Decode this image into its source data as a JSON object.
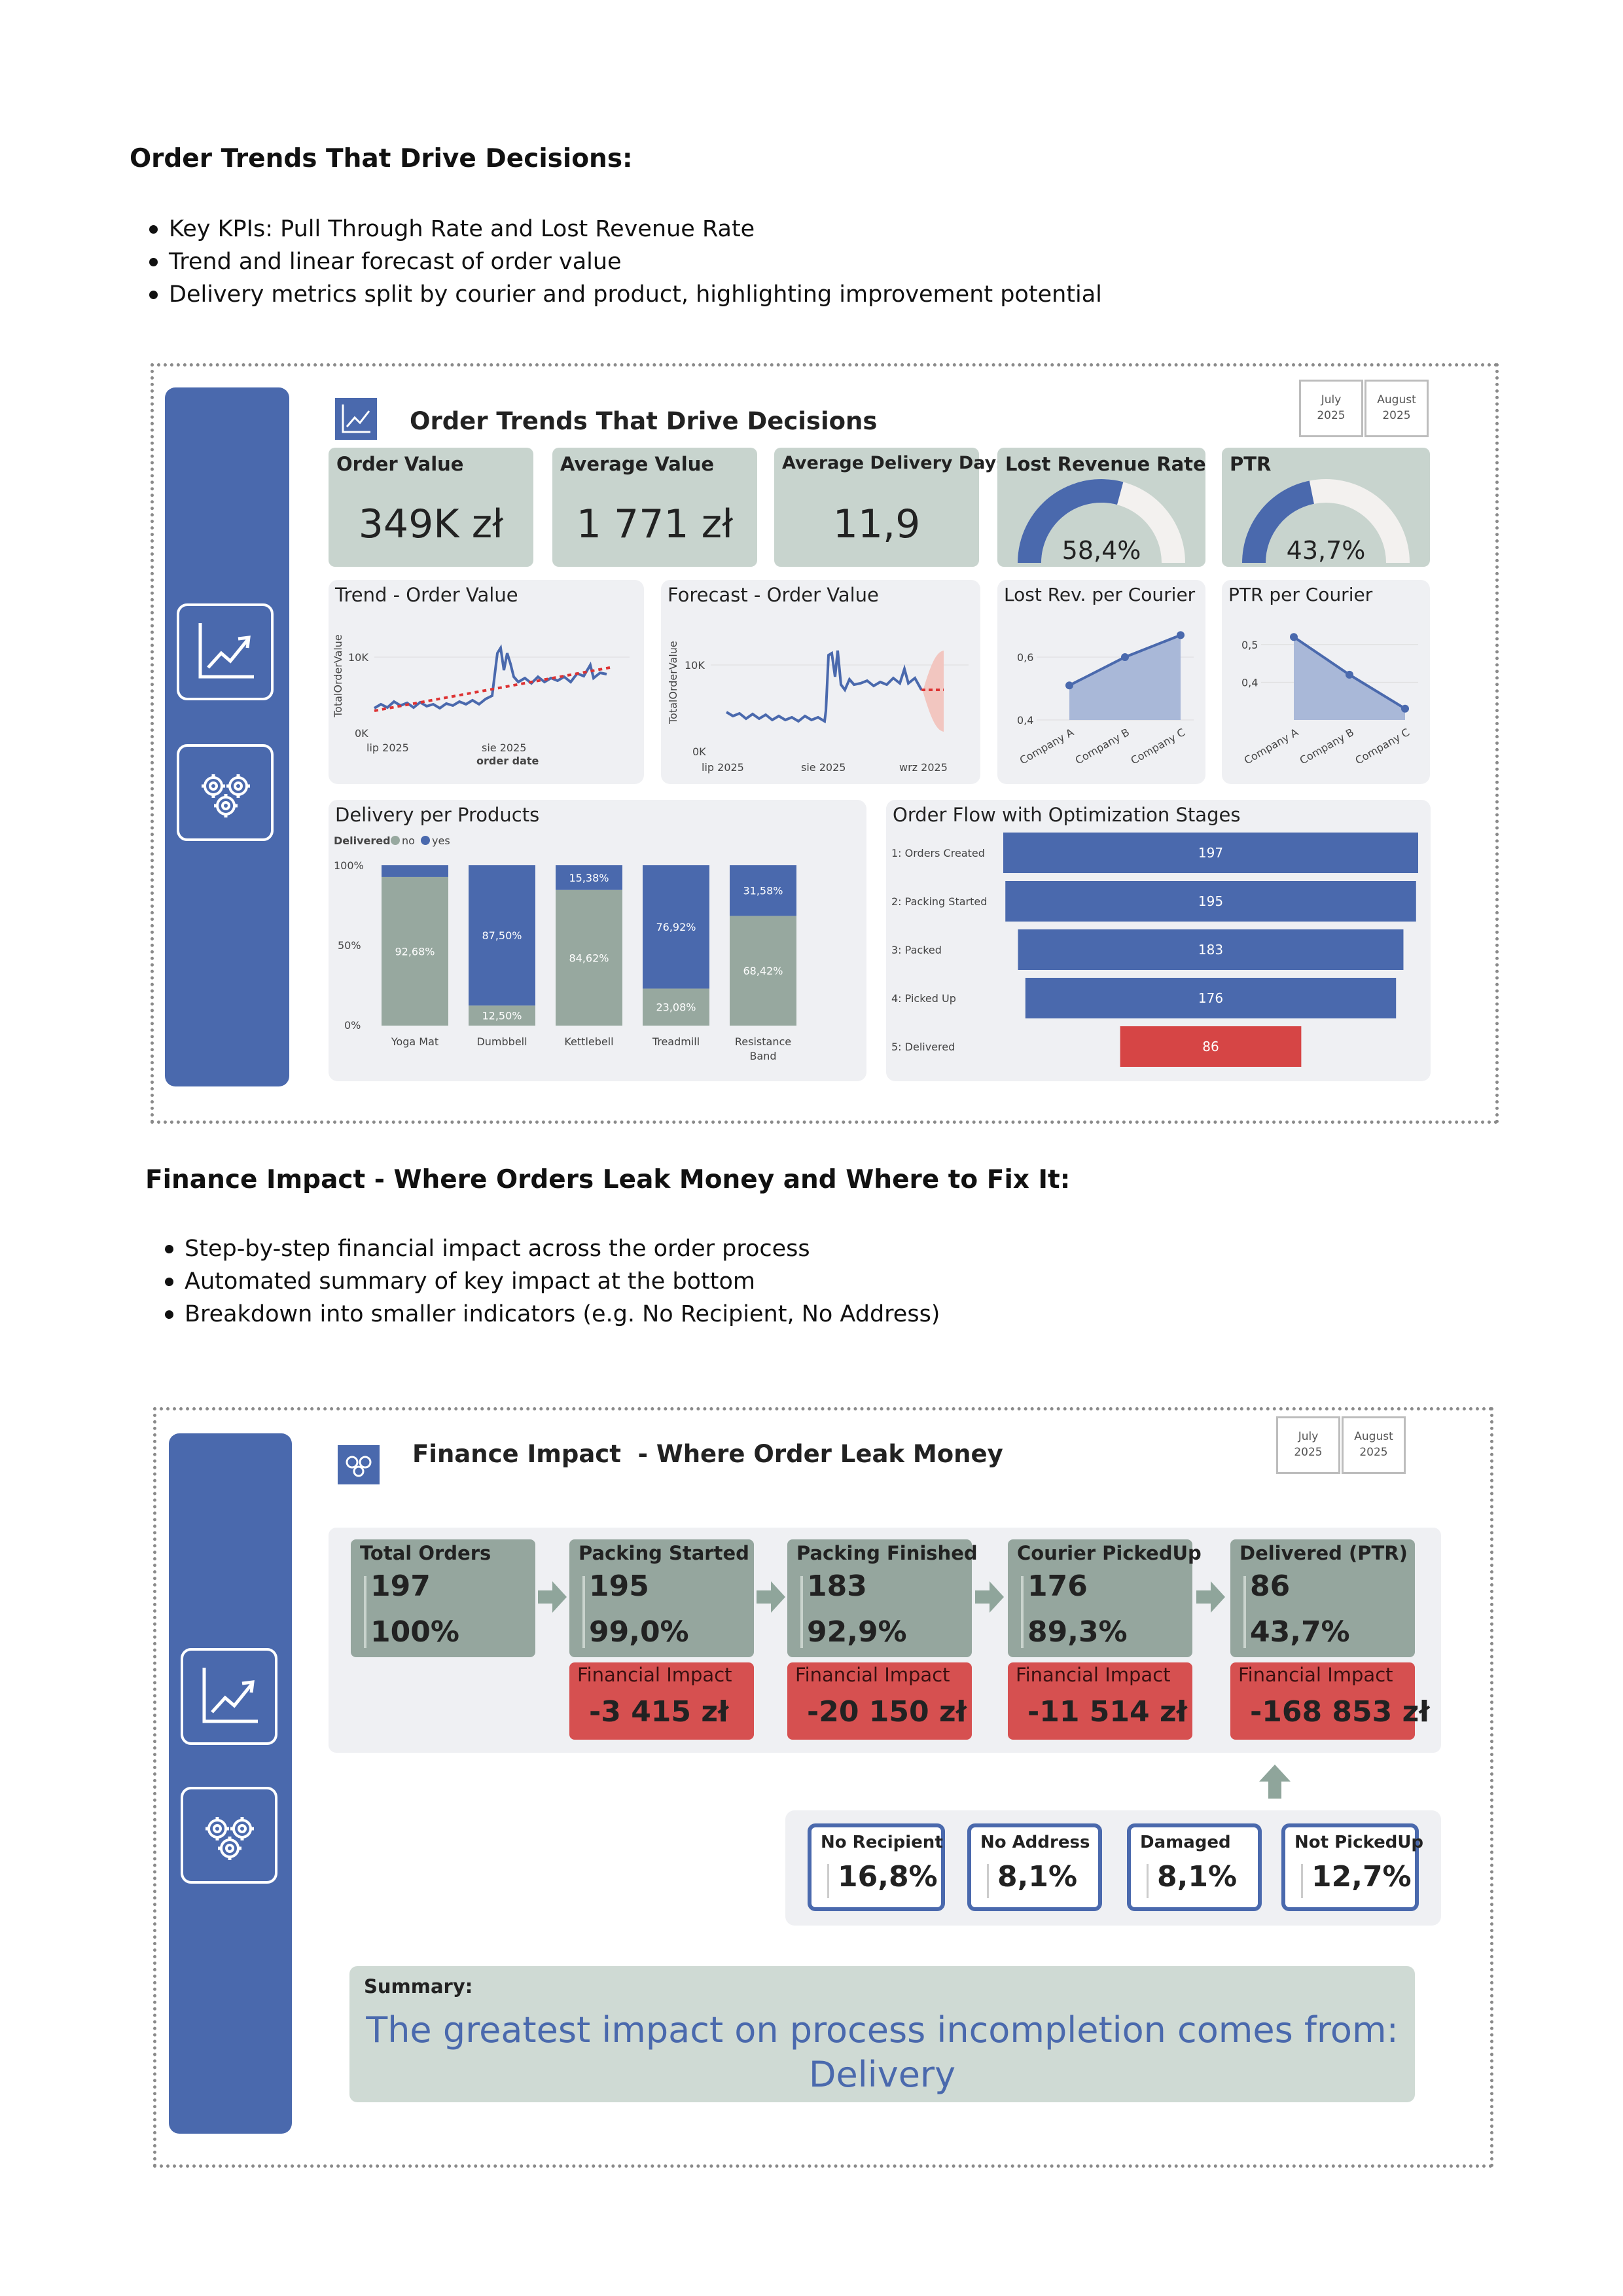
{
  "section1": {
    "heading": "Order Trends That Drive Decisions:",
    "bullets": [
      "Key KPIs: Pull Through Rate and Lost Revenue Rate",
      "Trend and linear forecast of order value",
      "Delivery metrics split by courier and product, highlighting improvement potential"
    ]
  },
  "dashboard1": {
    "title": "Order Trends That Drive Decisions",
    "month_buttons": [
      {
        "line1": "July",
        "line2": "2025"
      },
      {
        "line1": "August",
        "line2": "2025"
      }
    ],
    "kpis": [
      {
        "label": "Order Value",
        "value": "349K zł"
      },
      {
        "label": "Average Value",
        "value": "1 771 zł"
      },
      {
        "label": "Average Delivery Days",
        "value": "11,9"
      }
    ],
    "gauges": [
      {
        "label": "Lost Revenue Rate",
        "value_text": "58,4%",
        "value": 0.584
      },
      {
        "label": "PTR",
        "value_text": "43,7%",
        "value": 0.437
      }
    ],
    "trend": {
      "title": "Trend - Order Value",
      "ylabel": "TotalOrderValue",
      "xlabel": "order date",
      "yticks": [
        "10K",
        "0K"
      ],
      "xticks": [
        "lip 2025",
        "sie 2025"
      ]
    },
    "forecast": {
      "title": "Forecast - Order Value",
      "ylabel": "TotalOrderValue",
      "yticks": [
        "10K",
        "0K"
      ],
      "xticks": [
        "lip 2025",
        "sie 2025",
        "wrz 2025"
      ]
    },
    "delivery_products": {
      "title": "Delivery per Products",
      "legend_title": "Delivered",
      "legend": [
        "no",
        "yes"
      ],
      "yticks": [
        "100%",
        "50%",
        "0%"
      ]
    },
    "order_flow": {
      "title": "Order Flow with Optimization Stages"
    }
  },
  "chart_data": [
    {
      "type": "area",
      "title": "Lost Rev. per Courier",
      "categories": [
        "Company A",
        "Company B",
        "Company C"
      ],
      "values": [
        0.51,
        0.6,
        0.67
      ],
      "yticks": [
        "0,6",
        "0,4"
      ],
      "ylim": [
        0.4,
        0.7
      ]
    },
    {
      "type": "area",
      "title": "PTR per Courier",
      "categories": [
        "Company A",
        "Company B",
        "Company C"
      ],
      "values": [
        0.52,
        0.42,
        0.33
      ],
      "yticks": [
        "0,5",
        "0,4"
      ],
      "ylim": [
        0.3,
        0.55
      ]
    },
    {
      "type": "bar",
      "title": "Delivery per Products",
      "stacked": true,
      "categories": [
        "Yoga Mat",
        "Dumbbell",
        "Kettlebell",
        "Treadmill",
        "Resistance Band"
      ],
      "series": [
        {
          "name": "no",
          "values": [
            92.68,
            12.5,
            84.62,
            23.08,
            68.42
          ],
          "labels": [
            "92,68%",
            "12,50%",
            "84,62%",
            "23,08%",
            "68,42%"
          ]
        },
        {
          "name": "yes",
          "values": [
            7.32,
            87.5,
            15.38,
            76.92,
            31.58
          ],
          "labels": [
            "",
            "87,50%",
            "15,38%",
            "76,92%",
            "31,58%"
          ]
        }
      ],
      "ylim": [
        0,
        100
      ]
    },
    {
      "type": "bar",
      "title": "Order Flow with Optimization Stages",
      "orientation": "horizontal-funnel",
      "categories": [
        "1: Orders Created",
        "2: Packing Started",
        "3: Packed",
        "4: Picked Up",
        "5: Delivered"
      ],
      "values": [
        197,
        195,
        183,
        176,
        86
      ]
    }
  ],
  "section2": {
    "heading": "Finance Impact - Where Orders Leak Money and Where to Fix It:",
    "bullets": [
      "Step-by-step financial impact across the order process",
      "Automated summary of key impact at the bottom",
      "Breakdown into smaller indicators (e.g. No Recipient, No Address)"
    ]
  },
  "dashboard2": {
    "title": "Finance Impact  - Where Order Leak Money",
    "month_buttons": [
      {
        "line1": "July",
        "line2": "2025"
      },
      {
        "line1": "August",
        "line2": "2025"
      }
    ],
    "steps": [
      {
        "label": "Total Orders",
        "count": "197",
        "pct": "100%"
      },
      {
        "label": "Packing Started",
        "count": "195",
        "pct": "99,0%",
        "impact_label": "Financial Impact",
        "impact": "-3 415 zł"
      },
      {
        "label": "Packing Finished",
        "count": "183",
        "pct": "92,9%",
        "impact_label": "Financial Impact",
        "impact": "-20 150 zł"
      },
      {
        "label": "Courier PickedUp",
        "count": "176",
        "pct": "89,3%",
        "impact_label": "Financial Impact",
        "impact": "-11 514 zł"
      },
      {
        "label": "Delivered (PTR)",
        "count": "86",
        "pct": "43,7%",
        "impact_label": "Financial Impact",
        "impact": "-168 853 zł"
      }
    ],
    "indicators": [
      {
        "label": "No Recipient",
        "value": "16,8%"
      },
      {
        "label": "No Address",
        "value": "8,1%"
      },
      {
        "label": "Damaged",
        "value": "8,1%"
      },
      {
        "label": "Not PickedUp",
        "value": "12,7%"
      }
    ],
    "summary": {
      "label": "Summary:",
      "line1": "The greatest impact on process incompletion comes from:",
      "line2": "Delivery"
    }
  },
  "colors": {
    "sidebar": "#4a69ad",
    "tile": "#c8d4ce",
    "step": "#95a69e",
    "impact": "#d65050",
    "series_yes": "#4a69ad",
    "series_no": "#97a89f",
    "delivered_bar": "#d64545"
  }
}
